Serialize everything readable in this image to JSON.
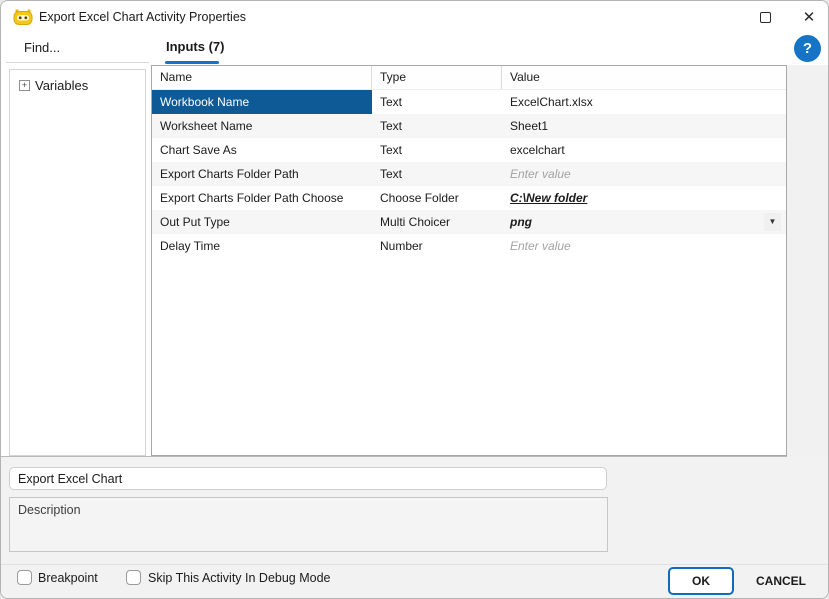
{
  "window": {
    "title": "Export Excel Chart Activity Properties",
    "icon": "robot-icon",
    "maximize_glyph": "maximize",
    "close_glyph": "✕"
  },
  "colors": {
    "accent_blue": "#1473c5",
    "selection_blue": "#0d5a96",
    "help_blue": "#1574c6",
    "ok_border_blue": "#0f6cbd",
    "alt_row": "#f6f6f6",
    "placeholder_gray": "#a3a3a3"
  },
  "sidebar": {
    "find_label": "Find...",
    "tree": [
      {
        "label": "Variables",
        "expander": "+"
      }
    ]
  },
  "tabs": [
    {
      "label": "Inputs (7)",
      "active": true
    }
  ],
  "help": {
    "label": "?"
  },
  "table": {
    "columns": [
      "Name",
      "Type",
      "Value"
    ],
    "rows": [
      {
        "name": "Workbook Name",
        "type": "Text",
        "value": "ExcelChart.xlsx",
        "selected": true,
        "style": "normal"
      },
      {
        "name": "Worksheet Name",
        "type": "Text",
        "value": "Sheet1",
        "style": "normal"
      },
      {
        "name": "Chart Save As",
        "type": "Text",
        "value": "excelchart",
        "style": "normal"
      },
      {
        "name": "Export Charts Folder Path",
        "type": "Text",
        "value": "Enter value",
        "style": "placeholder"
      },
      {
        "name": "Export Charts Folder Path Choose",
        "type": "Choose Folder",
        "value": "C:\\New folder",
        "style": "link"
      },
      {
        "name": "Out Put Type",
        "type": "Multi Choicer",
        "value": "png",
        "style": "italic",
        "dropdown": true
      },
      {
        "name": "Delay Time",
        "type": "Number",
        "value": "Enter value",
        "style": "placeholder"
      }
    ]
  },
  "display_name": {
    "value": "Export Excel Chart"
  },
  "description": {
    "placeholder": "Description"
  },
  "footer": {
    "checkboxes": [
      {
        "label": "Breakpoint",
        "checked": false
      },
      {
        "label": "Skip This Activity In Debug Mode",
        "checked": false
      }
    ],
    "ok_label": "OK",
    "cancel_label": "CANCEL"
  }
}
